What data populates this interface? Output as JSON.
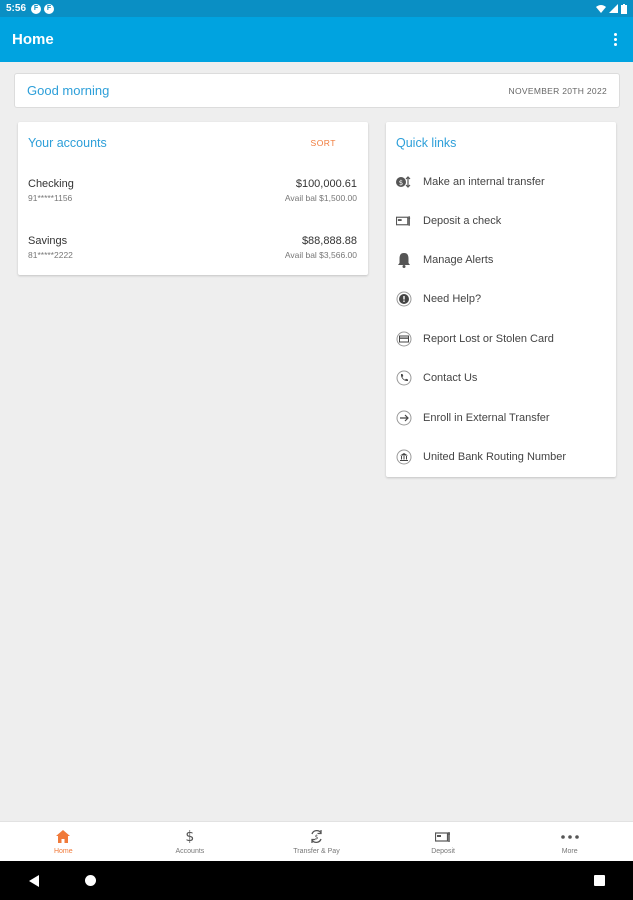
{
  "status_bar": {
    "time": "5:56",
    "icons": [
      "app-icon",
      "app-icon"
    ],
    "right_icons": [
      "wifi-icon",
      "signal-icon",
      "battery-icon"
    ]
  },
  "app_bar": {
    "title": "Home"
  },
  "greeting": {
    "text": "Good morning",
    "date": "NOVEMBER 20TH 2022"
  },
  "accounts": {
    "title": "Your accounts",
    "sort_label": "SORT",
    "items": [
      {
        "name": "Checking",
        "number": "91*****1156",
        "balance": "$100,000.61",
        "available": "Avail bal $1,500.00"
      },
      {
        "name": "Savings",
        "number": "81*****2222",
        "balance": "$88,888.88",
        "available": "Avail bal $3,566.00"
      }
    ]
  },
  "quick_links": {
    "title": "Quick links",
    "items": [
      {
        "label": "Make an internal transfer",
        "icon": "transfer-icon"
      },
      {
        "label": "Deposit a check",
        "icon": "check-icon"
      },
      {
        "label": "Manage Alerts",
        "icon": "bell-icon"
      },
      {
        "label": "Need Help?",
        "icon": "help-icon"
      },
      {
        "label": "Report Lost or Stolen Card",
        "icon": "card-icon"
      },
      {
        "label": "Contact Us",
        "icon": "phone-icon"
      },
      {
        "label": "Enroll in External Transfer",
        "icon": "arrow-right-icon"
      },
      {
        "label": "United Bank Routing Number",
        "icon": "bank-icon"
      }
    ]
  },
  "bottom_nav": {
    "items": [
      {
        "label": "Home",
        "icon": "home-icon",
        "active": true
      },
      {
        "label": "Accounts",
        "icon": "dollar-icon",
        "active": false
      },
      {
        "label": "Transfer & Pay",
        "icon": "transfer-pay-icon",
        "active": false
      },
      {
        "label": "Deposit",
        "icon": "deposit-icon",
        "active": false
      },
      {
        "label": "More",
        "icon": "more-icon",
        "active": false
      }
    ]
  },
  "colors": {
    "primary": "#00a3e0",
    "accent": "#f07a3a",
    "link": "#2d9fd9"
  }
}
